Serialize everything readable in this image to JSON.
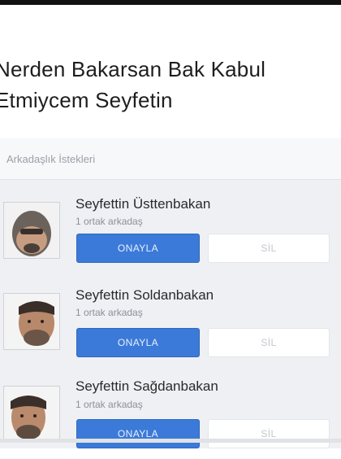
{
  "caption": {
    "line1": "Nerden Bakarsan Bak Kabul",
    "line2": "Etmiycem Seyfetin"
  },
  "panel": {
    "title": "Arkadaşlık İstekleri"
  },
  "requests": [
    {
      "name": "Seyfettin Üsttenbakan",
      "mutual": "1 ortak arkadaş",
      "confirm_label": "ONAYLA",
      "delete_label": "SİL"
    },
    {
      "name": "Seyfettin Soldanbakan",
      "mutual": "1 ortak arkadaş",
      "confirm_label": "ONAYLA",
      "delete_label": "SİL"
    },
    {
      "name": "Seyfettin Sağdanbakan",
      "mutual": "1 ortak arkadaş",
      "confirm_label": "ONAYLA",
      "delete_label": "SİL"
    }
  ],
  "colors": {
    "confirm_button": "#3b7ad8",
    "delete_button": "#ffffff",
    "panel_background": "#eef0f4"
  }
}
